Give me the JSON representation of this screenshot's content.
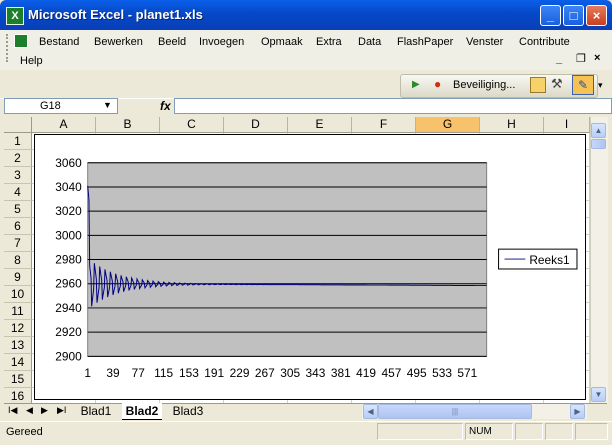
{
  "window": {
    "title": "Microsoft Excel - planet1.xls",
    "app_icon_letter": "X",
    "minimize": "_",
    "maximize": "□",
    "close": "×"
  },
  "menu": {
    "items": [
      "Bestand",
      "Bewerken",
      "Beeld",
      "Invoegen",
      "Opmaak",
      "Extra",
      "Data",
      "FlashPaper",
      "Venster",
      "Contribute"
    ],
    "second_row": "Help"
  },
  "toolbar": {
    "security_label": "Beveiliging...",
    "run_icon": "play-icon",
    "record_icon": "record-icon"
  },
  "formula_bar": {
    "name_box": "G18",
    "fx": "fx",
    "formula": ""
  },
  "grid": {
    "columns": [
      "A",
      "B",
      "C",
      "D",
      "E",
      "F",
      "G",
      "H",
      "I"
    ],
    "selected_column": "G",
    "rows": [
      "1",
      "2",
      "3",
      "4",
      "5",
      "6",
      "7",
      "8",
      "9",
      "10",
      "11",
      "12",
      "13",
      "14",
      "15",
      "16"
    ]
  },
  "chart_data": {
    "type": "line",
    "title": "",
    "xlabel": "",
    "ylabel": "",
    "ylim": [
      2900,
      3060
    ],
    "y_ticks": [
      "3060",
      "3040",
      "3020",
      "3000",
      "2980",
      "2960",
      "2940",
      "2920",
      "2900"
    ],
    "x_tick_labels": [
      "1",
      "39",
      "77",
      "115",
      "153",
      "191",
      "229",
      "267",
      "305",
      "343",
      "381",
      "419",
      "457",
      "495",
      "533",
      "571"
    ],
    "series": [
      {
        "name": "Reeks1",
        "color": "#000080",
        "start_value": 3041,
        "converged_value": 2960,
        "points": 600
      }
    ],
    "plot_background": "#c0c0c0",
    "grid": true,
    "legend_position": "right"
  },
  "sheet_tabs": {
    "tabs": [
      "Blad1",
      "Blad2",
      "Blad3"
    ],
    "active": "Blad2"
  },
  "status": {
    "text": "Gereed",
    "num": "NUM"
  }
}
